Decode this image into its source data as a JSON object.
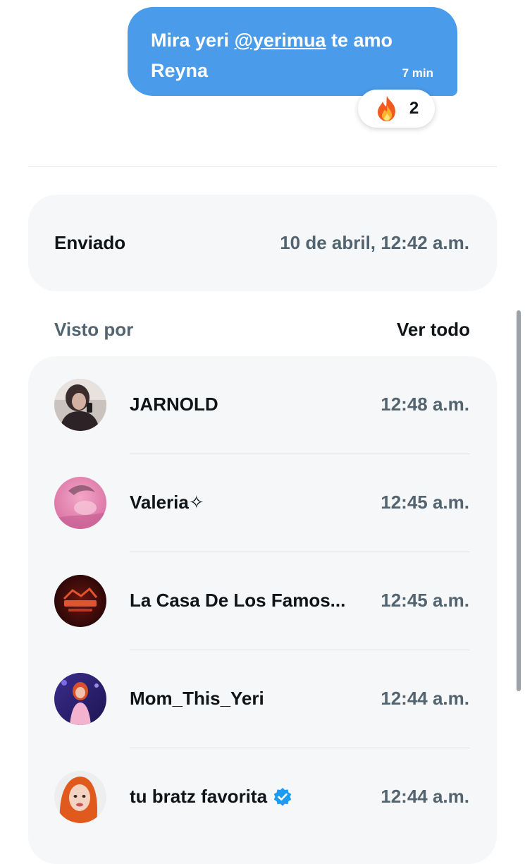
{
  "message": {
    "text_before": "Mira yeri ",
    "mention": "@yerimua",
    "text_after": " te amo Reyna",
    "time": "7 min",
    "reaction": {
      "icon": "fire-icon",
      "count": "2"
    },
    "bubble_color": "#4a9be9"
  },
  "sent": {
    "label": "Enviado",
    "value": "10 de abril, 12:42 a.m."
  },
  "seen": {
    "label": "Visto por",
    "see_all": "Ver todo",
    "rows": [
      {
        "name": "JARNOLD",
        "time": "12:48 a.m.",
        "avatar": "avatar-photo-dark"
      },
      {
        "name": "Valeria✧",
        "time": "12:45 a.m.",
        "avatar": "avatar-photo-pink"
      },
      {
        "name": "La Casa De Los Famos...",
        "time": "12:45 a.m.",
        "avatar": "avatar-logo-red"
      },
      {
        "name": "Mom_This_Yeri",
        "time": "12:44 a.m.",
        "avatar": "avatar-photo-stage"
      },
      {
        "name": "tu bratz favorita",
        "time": "12:44 a.m.",
        "avatar": "avatar-photo-orange-hair",
        "verified": true
      }
    ]
  },
  "colors": {
    "secondary_text": "#536471",
    "card_bg": "#f6f7f8",
    "verified": "#1d9bf0"
  }
}
